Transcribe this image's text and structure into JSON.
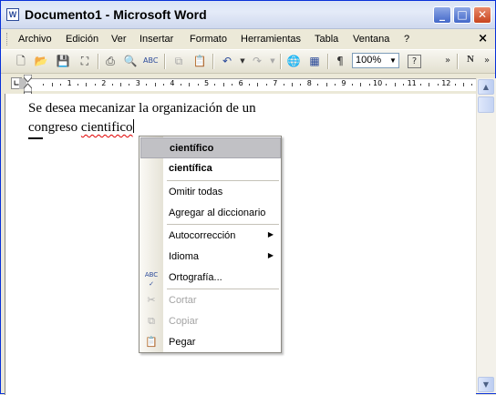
{
  "window": {
    "title": "Documento1 - Microsoft Word",
    "app_icon_letter": "W"
  },
  "menubar": {
    "items": [
      "Archivo",
      "Edición",
      "Ver",
      "Insertar",
      "Formato",
      "Herramientas",
      "Tabla",
      "Ventana",
      "?"
    ],
    "close_glyph": "×"
  },
  "toolbar": {
    "zoom": "100%",
    "icons": [
      "new-document",
      "open",
      "save",
      "permission",
      "print",
      "print-preview",
      "spelling",
      "cut",
      "copy",
      "undo",
      "redo",
      "insert-hyperlink",
      "tables-and-borders",
      "show-formatting",
      "zoom",
      "help",
      "more-options",
      "bold"
    ]
  },
  "ruler": {
    "numbers": [
      "1",
      "2",
      "3",
      "4",
      "5",
      "6",
      "7",
      "8",
      "9",
      "10",
      "11",
      "12"
    ]
  },
  "document": {
    "line1": "Se desea mecanizar la organización de un",
    "line2_start": "congreso ",
    "misspelled_word": "cientifico"
  },
  "context_menu": {
    "suggestion1": "científico",
    "suggestion2": "científica",
    "ignore_all": "Omitir todas",
    "add_to_dictionary": "Agregar al diccionario",
    "autocorrect": "Autocorrección",
    "language": "Idioma",
    "spelling": "Ortografía...",
    "cut": "Cortar",
    "copy": "Copiar",
    "paste": "Pegar"
  }
}
